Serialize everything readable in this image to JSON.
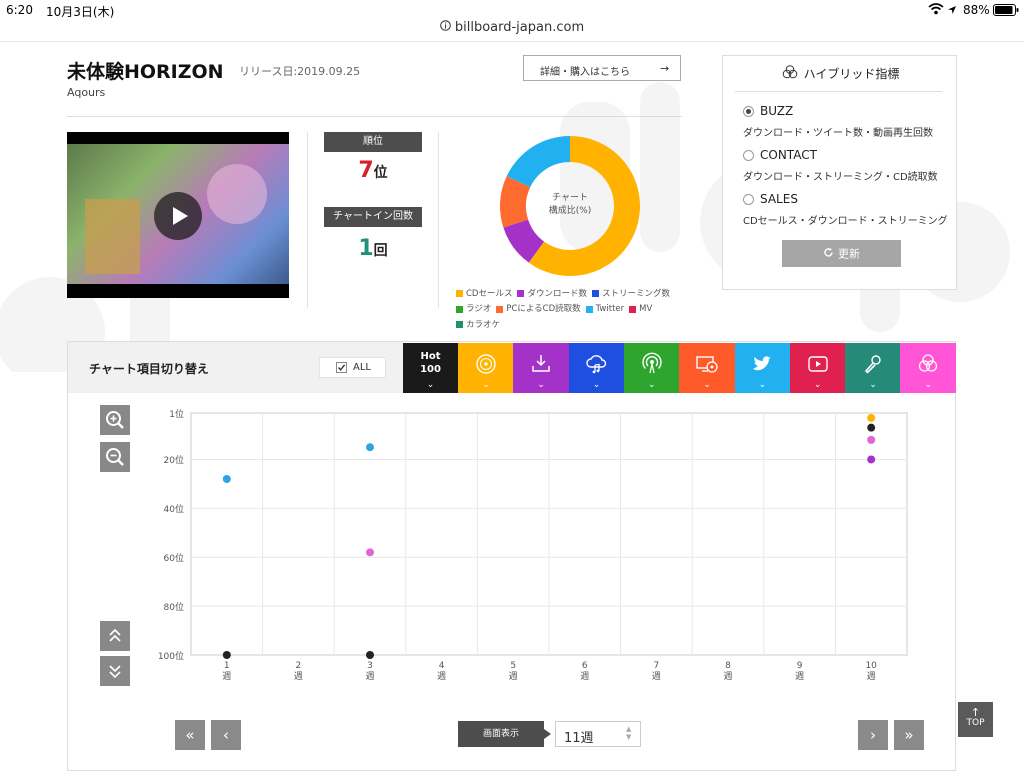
{
  "status": {
    "time": "6:20",
    "date": "10月3日(木)",
    "battery": "88%"
  },
  "url": "billboard-japan.com",
  "song": {
    "title": "未体験HORIZON",
    "release": "リリース日:2019.09.25",
    "artist": "Aqours",
    "detail_button": "詳細・購入はこちら",
    "arrow": "→"
  },
  "rank": {
    "label": "順位",
    "value": "7",
    "unit": "位"
  },
  "chart_in": {
    "label": "チャートイン回数",
    "value": "1",
    "unit": "回"
  },
  "donut": {
    "center_line1": "チャート",
    "center_line2": "構成比(%)",
    "segments": [
      {
        "name": "CDセールス",
        "value": 60,
        "color": "#FFB300"
      },
      {
        "name": "ダウンロード数",
        "value": 10,
        "color": "#A532C8"
      },
      {
        "name": "ストリーミング数",
        "value": 0,
        "color": "#1E4FE0"
      },
      {
        "name": "ラジオ",
        "value": 0,
        "color": "#2EA52E"
      },
      {
        "name": "PCによるCD読取数",
        "value": 12,
        "color": "#FF6A2E"
      },
      {
        "name": "Twitter",
        "value": 18,
        "color": "#22B1F0"
      },
      {
        "name": "MV",
        "value": 0,
        "color": "#E02050"
      },
      {
        "name": "カラオケ",
        "value": 0,
        "color": "#22906F"
      }
    ]
  },
  "hybrid": {
    "title": "ハイブリッド指標",
    "options": [
      {
        "label": "BUZZ",
        "desc": "ダウンロード・ツイート数・動画再生回数",
        "selected": true
      },
      {
        "label": "CONTACT",
        "desc": "ダウンロード・ストリーミング・CD読取数",
        "selected": false
      },
      {
        "label": "SALES",
        "desc": "CDセールス・ダウンロード・ストリーミング",
        "selected": false
      }
    ],
    "refresh": "更新"
  },
  "switcher": {
    "label": "チャート項目切り替え",
    "all_label": "ALL",
    "hot_line1": "Hot",
    "hot_line2": "100",
    "tabs": [
      {
        "icon": "cd-icon",
        "color": "#FFB300"
      },
      {
        "icon": "download-icon",
        "color": "#A532C8"
      },
      {
        "icon": "streaming-icon",
        "color": "#1E4FE0"
      },
      {
        "icon": "radio-icon",
        "color": "#2EA52E"
      },
      {
        "icon": "pc-cd-icon",
        "color": "#FF5A2A"
      },
      {
        "icon": "twitter-icon",
        "color": "#22B1F0"
      },
      {
        "icon": "mv-icon",
        "color": "#E0204F"
      },
      {
        "icon": "karaoke-icon",
        "color": "#268A78"
      },
      {
        "icon": "hybrid-icon",
        "color": "#FF55D6"
      }
    ]
  },
  "chart_data": {
    "type": "scatter",
    "y_ticks": [
      "1位",
      "20位",
      "40位",
      "60位",
      "80位",
      "100位"
    ],
    "y_values": [
      1,
      20,
      40,
      60,
      80,
      100
    ],
    "ylim": [
      1,
      100
    ],
    "y_inverted": true,
    "x_ticks": [
      "1",
      "2",
      "3",
      "4",
      "5",
      "6",
      "7",
      "8",
      "9",
      "10"
    ],
    "x_unit": "週",
    "xlim": [
      1,
      10
    ],
    "grid": true,
    "series": [
      {
        "color": "#2EA4E0",
        "points": [
          [
            1,
            28
          ],
          [
            3,
            15
          ]
        ]
      },
      {
        "color": "#E066D6",
        "points": [
          [
            3,
            58
          ],
          [
            10,
            12
          ]
        ]
      },
      {
        "color": "#222222",
        "points": [
          [
            1,
            100
          ],
          [
            3,
            100
          ],
          [
            10,
            7
          ]
        ]
      },
      {
        "color": "#FFB300",
        "points": [
          [
            10,
            3
          ]
        ]
      },
      {
        "color": "#A532C8",
        "points": [
          [
            10,
            20
          ]
        ]
      }
    ]
  },
  "pager": {
    "display_label": "画面表示",
    "weeks_value": "11週",
    "first": "«",
    "prev": "‹",
    "next": "›",
    "last": "»"
  },
  "top_button": {
    "arrow": "↑",
    "label": "TOP"
  },
  "zoom": {
    "in": "+",
    "out": "−"
  },
  "scroll": {
    "up": "︽",
    "down": "︾"
  }
}
